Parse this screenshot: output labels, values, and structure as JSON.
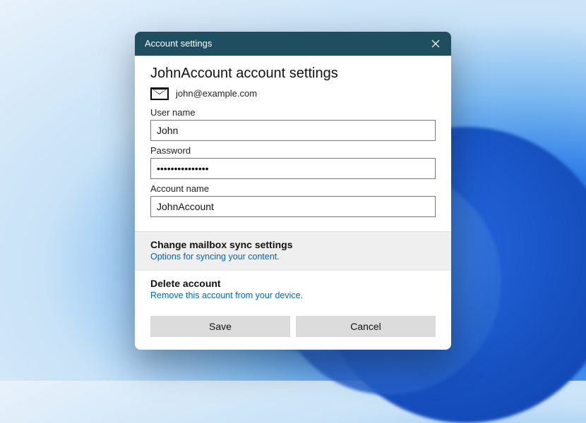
{
  "titlebar": {
    "title": "Account settings"
  },
  "heading": "JohnAccount account settings",
  "email": "john@example.com",
  "fields": {
    "username_label": "User name",
    "username_value": "John",
    "password_label": "Password",
    "password_value": "•••••••••••••••",
    "account_label": "Account name",
    "account_value": "JohnAccount"
  },
  "sync": {
    "title": "Change mailbox sync settings",
    "subtitle": "Options for syncing your content."
  },
  "del": {
    "title": "Delete account",
    "subtitle": "Remove this account from your device."
  },
  "buttons": {
    "save": "Save",
    "cancel": "Cancel"
  }
}
